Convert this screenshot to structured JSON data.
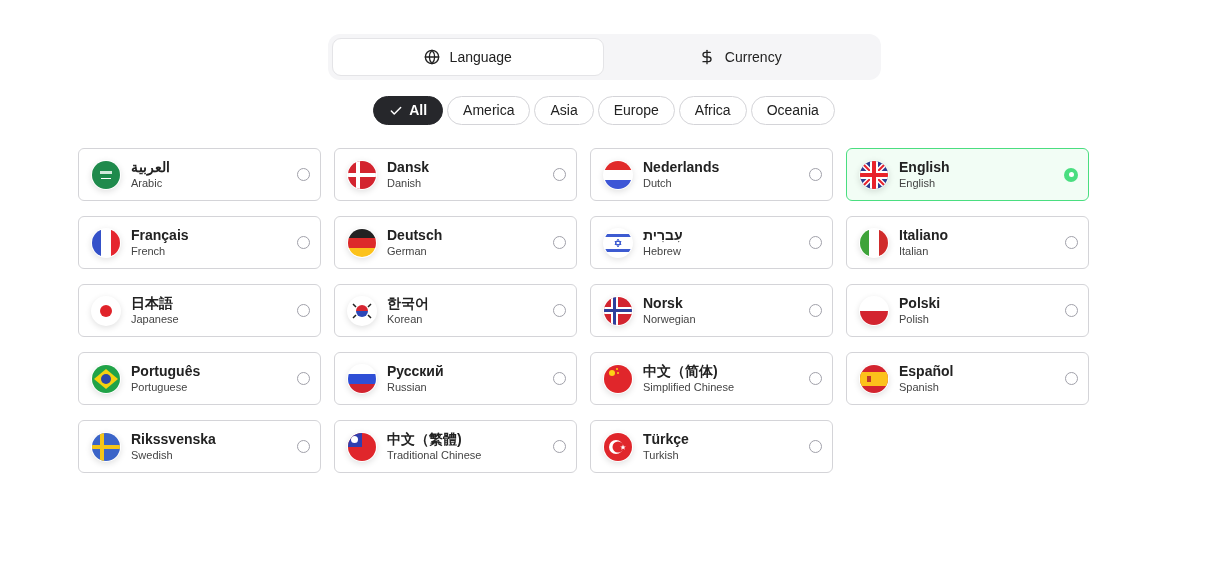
{
  "tabs": [
    {
      "label": "Language",
      "selected": true
    },
    {
      "label": "Currency",
      "selected": false
    }
  ],
  "filters": [
    {
      "label": "All",
      "selected": true
    },
    {
      "label": "America",
      "selected": false
    },
    {
      "label": "Asia",
      "selected": false
    },
    {
      "label": "Europe",
      "selected": false
    },
    {
      "label": "Africa",
      "selected": false
    },
    {
      "label": "Oceania",
      "selected": false
    }
  ],
  "languages": [
    {
      "native": "العربية",
      "english": "Arabic",
      "selected": false
    },
    {
      "native": "Dansk",
      "english": "Danish",
      "selected": false
    },
    {
      "native": "Nederlands",
      "english": "Dutch",
      "selected": false
    },
    {
      "native": "English",
      "english": "English",
      "selected": true
    },
    {
      "native": "Français",
      "english": "French",
      "selected": false
    },
    {
      "native": "Deutsch",
      "english": "German",
      "selected": false
    },
    {
      "native": "עִברִית",
      "english": "Hebrew",
      "selected": false
    },
    {
      "native": "Italiano",
      "english": "Italian",
      "selected": false
    },
    {
      "native": "日本語",
      "english": "Japanese",
      "selected": false
    },
    {
      "native": "한국어",
      "english": "Korean",
      "selected": false
    },
    {
      "native": "Norsk",
      "english": "Norwegian",
      "selected": false
    },
    {
      "native": "Polski",
      "english": "Polish",
      "selected": false
    },
    {
      "native": "Português",
      "english": "Portuguese",
      "selected": false
    },
    {
      "native": "Русский",
      "english": "Russian",
      "selected": false
    },
    {
      "native": "中文（简体)",
      "english": "Simplified Chinese",
      "selected": false
    },
    {
      "native": "Español",
      "english": "Spanish",
      "selected": false
    },
    {
      "native": "Rikssvenska",
      "english": "Swedish",
      "selected": false
    },
    {
      "native": "中文（繁體)",
      "english": "Traditional Chinese",
      "selected": false
    },
    {
      "native": "Türkçe",
      "english": "Turkish",
      "selected": false
    }
  ]
}
